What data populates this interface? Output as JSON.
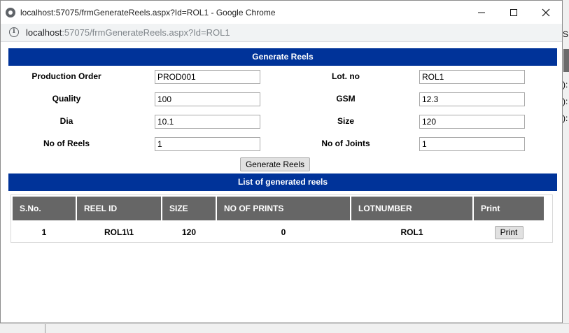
{
  "window": {
    "title": "localhost:57075/frmGenerateReels.aspx?Id=ROL1 - Google Chrome",
    "url_host": "localhost",
    "url_rest": ":57075/frmGenerateReels.aspx?Id=ROL1"
  },
  "background_chars": [
    "S",
    "):",
    "):",
    "):"
  ],
  "form": {
    "header": "Generate Reels",
    "production_order": {
      "label": "Production Order",
      "value": "PROD001"
    },
    "lot_no": {
      "label": "Lot. no",
      "value": "ROL1"
    },
    "quality": {
      "label": "Quality",
      "value": "100"
    },
    "gsm": {
      "label": "GSM",
      "value": "12.3"
    },
    "dia": {
      "label": "Dia",
      "value": "10.1"
    },
    "size": {
      "label": "Size",
      "value": "120"
    },
    "no_of_reels": {
      "label": "No of Reels",
      "value": "1"
    },
    "no_of_joints": {
      "label": "No of Joints",
      "value": "1"
    },
    "generate_button": "Generate Reels"
  },
  "list": {
    "header": "List of generated reels",
    "columns": [
      "S.No.",
      "REEL ID",
      "SIZE",
      "NO OF PRINTS",
      "LOTNUMBER",
      "Print"
    ],
    "rows": [
      {
        "sno": "1",
        "reel_id": "ROL1\\1",
        "size": "120",
        "prints": "0",
        "lotnumber": "ROL1",
        "print_label": "Print"
      }
    ]
  },
  "colors": {
    "header_bg": "#003399",
    "grid_header_bg": "#666666"
  }
}
